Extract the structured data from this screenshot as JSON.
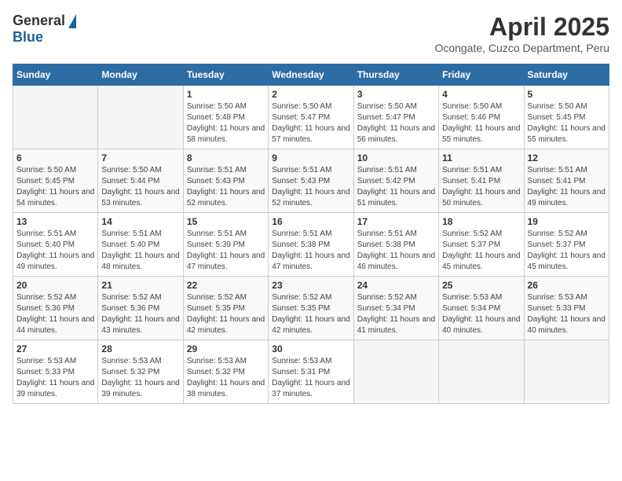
{
  "header": {
    "logo_general": "General",
    "logo_blue": "Blue",
    "title": "April 2025",
    "location": "Ocongate, Cuzco Department, Peru"
  },
  "weekdays": [
    "Sunday",
    "Monday",
    "Tuesday",
    "Wednesday",
    "Thursday",
    "Friday",
    "Saturday"
  ],
  "weeks": [
    [
      {
        "day": null
      },
      {
        "day": null
      },
      {
        "day": "1",
        "sunrise": "5:50 AM",
        "sunset": "5:48 PM",
        "daylight": "11 hours and 58 minutes."
      },
      {
        "day": "2",
        "sunrise": "5:50 AM",
        "sunset": "5:47 PM",
        "daylight": "11 hours and 57 minutes."
      },
      {
        "day": "3",
        "sunrise": "5:50 AM",
        "sunset": "5:47 PM",
        "daylight": "11 hours and 56 minutes."
      },
      {
        "day": "4",
        "sunrise": "5:50 AM",
        "sunset": "5:46 PM",
        "daylight": "11 hours and 55 minutes."
      },
      {
        "day": "5",
        "sunrise": "5:50 AM",
        "sunset": "5:45 PM",
        "daylight": "11 hours and 55 minutes."
      }
    ],
    [
      {
        "day": "6",
        "sunrise": "5:50 AM",
        "sunset": "5:45 PM",
        "daylight": "11 hours and 54 minutes."
      },
      {
        "day": "7",
        "sunrise": "5:50 AM",
        "sunset": "5:44 PM",
        "daylight": "11 hours and 53 minutes."
      },
      {
        "day": "8",
        "sunrise": "5:51 AM",
        "sunset": "5:43 PM",
        "daylight": "11 hours and 52 minutes."
      },
      {
        "day": "9",
        "sunrise": "5:51 AM",
        "sunset": "5:43 PM",
        "daylight": "11 hours and 52 minutes."
      },
      {
        "day": "10",
        "sunrise": "5:51 AM",
        "sunset": "5:42 PM",
        "daylight": "11 hours and 51 minutes."
      },
      {
        "day": "11",
        "sunrise": "5:51 AM",
        "sunset": "5:41 PM",
        "daylight": "11 hours and 50 minutes."
      },
      {
        "day": "12",
        "sunrise": "5:51 AM",
        "sunset": "5:41 PM",
        "daylight": "11 hours and 49 minutes."
      }
    ],
    [
      {
        "day": "13",
        "sunrise": "5:51 AM",
        "sunset": "5:40 PM",
        "daylight": "11 hours and 49 minutes."
      },
      {
        "day": "14",
        "sunrise": "5:51 AM",
        "sunset": "5:40 PM",
        "daylight": "11 hours and 48 minutes."
      },
      {
        "day": "15",
        "sunrise": "5:51 AM",
        "sunset": "5:39 PM",
        "daylight": "11 hours and 47 minutes."
      },
      {
        "day": "16",
        "sunrise": "5:51 AM",
        "sunset": "5:38 PM",
        "daylight": "11 hours and 47 minutes."
      },
      {
        "day": "17",
        "sunrise": "5:51 AM",
        "sunset": "5:38 PM",
        "daylight": "11 hours and 46 minutes."
      },
      {
        "day": "18",
        "sunrise": "5:52 AM",
        "sunset": "5:37 PM",
        "daylight": "11 hours and 45 minutes."
      },
      {
        "day": "19",
        "sunrise": "5:52 AM",
        "sunset": "5:37 PM",
        "daylight": "11 hours and 45 minutes."
      }
    ],
    [
      {
        "day": "20",
        "sunrise": "5:52 AM",
        "sunset": "5:36 PM",
        "daylight": "11 hours and 44 minutes."
      },
      {
        "day": "21",
        "sunrise": "5:52 AM",
        "sunset": "5:36 PM",
        "daylight": "11 hours and 43 minutes."
      },
      {
        "day": "22",
        "sunrise": "5:52 AM",
        "sunset": "5:35 PM",
        "daylight": "11 hours and 42 minutes."
      },
      {
        "day": "23",
        "sunrise": "5:52 AM",
        "sunset": "5:35 PM",
        "daylight": "11 hours and 42 minutes."
      },
      {
        "day": "24",
        "sunrise": "5:52 AM",
        "sunset": "5:34 PM",
        "daylight": "11 hours and 41 minutes."
      },
      {
        "day": "25",
        "sunrise": "5:53 AM",
        "sunset": "5:34 PM",
        "daylight": "11 hours and 40 minutes."
      },
      {
        "day": "26",
        "sunrise": "5:53 AM",
        "sunset": "5:33 PM",
        "daylight": "11 hours and 40 minutes."
      }
    ],
    [
      {
        "day": "27",
        "sunrise": "5:53 AM",
        "sunset": "5:33 PM",
        "daylight": "11 hours and 39 minutes."
      },
      {
        "day": "28",
        "sunrise": "5:53 AM",
        "sunset": "5:32 PM",
        "daylight": "11 hours and 39 minutes."
      },
      {
        "day": "29",
        "sunrise": "5:53 AM",
        "sunset": "5:32 PM",
        "daylight": "11 hours and 38 minutes."
      },
      {
        "day": "30",
        "sunrise": "5:53 AM",
        "sunset": "5:31 PM",
        "daylight": "11 hours and 37 minutes."
      },
      {
        "day": null
      },
      {
        "day": null
      },
      {
        "day": null
      }
    ]
  ]
}
